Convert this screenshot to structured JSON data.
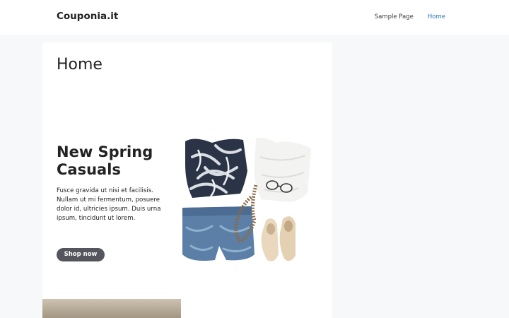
{
  "header": {
    "site_title": "Couponia.it",
    "nav": [
      {
        "label": "Sample Page"
      },
      {
        "label": "Home",
        "active": true
      }
    ]
  },
  "main": {
    "page_title": "Home",
    "hero": {
      "heading": "New Spring Casuals",
      "text": "Fusce gravida ut nisi et facilisis. Nullam ut mi fermentum, posuere dolor id, ultricies ipsum. Duis urna ipsum, tincidunt ut lorem.",
      "button_label": "Shop now",
      "image_icon": "spring-outfit-photo"
    }
  },
  "colors": {
    "background": "#f7f8f9",
    "link_active": "#1e73be",
    "button": "#55555e"
  }
}
